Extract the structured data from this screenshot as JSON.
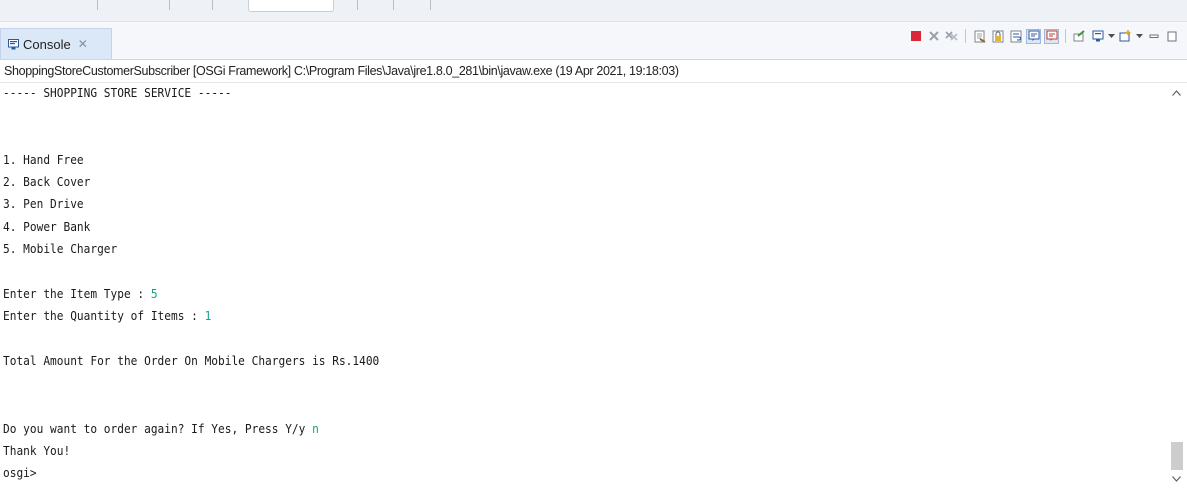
{
  "view": {
    "tab_label": "Console",
    "tab_close": "✕",
    "tab_icon": "console-monitor-icon"
  },
  "toolbar": {
    "icons": [
      "terminate-icon",
      "remove-launch-icon",
      "remove-all-terminated-icon",
      "clear-console-icon",
      "scroll-lock-icon",
      "word-wrap-icon",
      "show-console-on-stdout-icon",
      "show-console-on-stderr-icon",
      "pin-console-icon",
      "display-selected-console-icon",
      "open-console-icon",
      "minimize-icon",
      "maximize-icon"
    ]
  },
  "process": {
    "description": "ShoppingStoreCustomerSubscriber [OSGi Framework] C:\\Program Files\\Java\\jre1.8.0_281\\bin\\javaw.exe (19 Apr 2021, 19:18:03)"
  },
  "console": {
    "header": "----- SHOPPING STORE SERVICE -----",
    "menu": [
      "1. Hand Free",
      "2. Back Cover",
      "3. Pen Drive",
      "4. Power Bank",
      "5. Mobile Charger"
    ],
    "prompt_item_type": "Enter the Item Type : ",
    "input_item_type": "5",
    "prompt_quantity": "Enter the Quantity of Items : ",
    "input_quantity": "1",
    "total_line": "Total Amount For the Order On Mobile Chargers is Rs.1400",
    "prompt_again": "Do you want to order again? If Yes, Press Y/y ",
    "input_again": "n",
    "thanks": "Thank You!",
    "osgi_prompt": "osgi>"
  },
  "colors": {
    "input_text": "#14a38a",
    "tab_active": "#dbe8f8",
    "terminate_red": "#d9263a"
  }
}
